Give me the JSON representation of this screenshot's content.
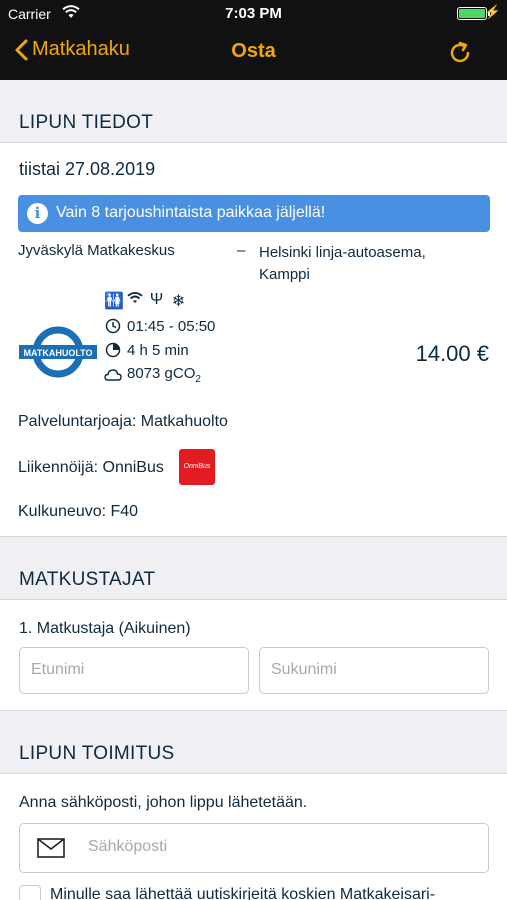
{
  "status_bar": {
    "carrier": "Carrier",
    "time": "7:03 PM"
  },
  "nav": {
    "back_label": "Matkahaku",
    "title": "Osta"
  },
  "ticket": {
    "section_title": "LIPUN TIEDOT",
    "date": "tiistai 27.08.2019",
    "banner": "Vain 8 tarjoushintaista paikkaa jäljellä!",
    "from": "Jyväskylä Matkakeskus",
    "separator": "–",
    "to_line1": "Helsinki linja-autoasema,",
    "to_line2": "Kamppi",
    "company_logo_text": "MATKAHUOLTO",
    "amenities": [
      "wc-icon",
      "wifi-icon",
      "usb-icon",
      "air-conditioning-icon"
    ],
    "time_range": "01:45 - 05:50",
    "duration": "4 h 5 min",
    "emissions_prefix": "8073 gCO",
    "emissions_sub": "2",
    "price": "14.00 €",
    "provider": "Palveluntarjoaja: Matkahuolto",
    "operator": "Liikennöijä: OnniBus",
    "operator_logo_text": "OnniBus",
    "vehicle": "Kulkuneuvo: F40"
  },
  "travellers": {
    "section_title": "MATKUSTAJAT",
    "traveller_label": "1. Matkustaja (Aikuinen)",
    "first_name_placeholder": "Etunimi",
    "last_name_placeholder": "Sukunimi"
  },
  "delivery": {
    "section_title": "LIPUN TOIMITUS",
    "instruction": "Anna sähköposti, johon lippu lähetetään.",
    "email_placeholder": "Sähköposti",
    "newsletter_label": "Minulle saa lähettää uutiskirjeitä koskien Matkakeisari-"
  },
  "colors": {
    "accent": "#f2a900",
    "banner": "#4a90e2",
    "text": "#0f2a3f",
    "navbar": "#111111"
  }
}
